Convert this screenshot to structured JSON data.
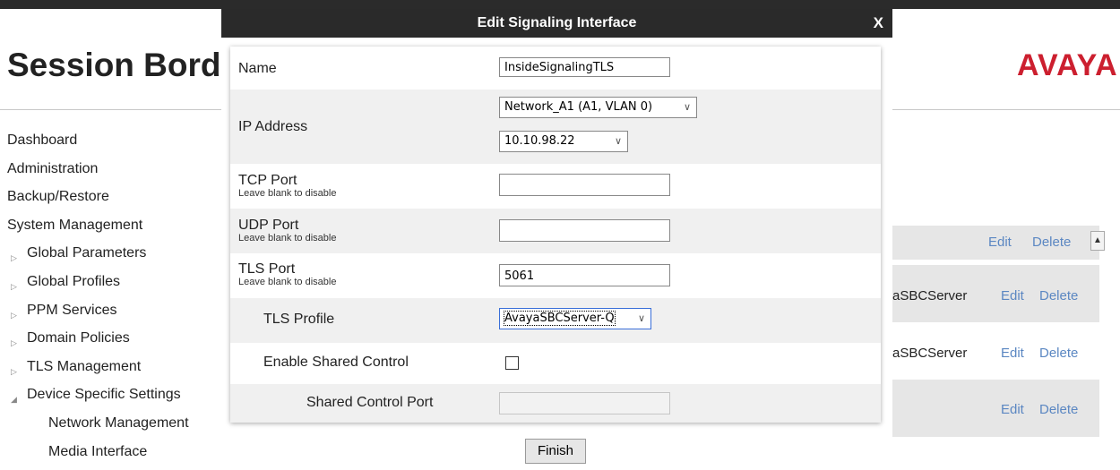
{
  "page": {
    "title": "Session Bord",
    "brand": "AVAYA"
  },
  "nav": {
    "items": [
      {
        "label": "Dashboard",
        "level": 1
      },
      {
        "label": "Administration",
        "level": 1
      },
      {
        "label": "Backup/Restore",
        "level": 1
      },
      {
        "label": "System Management",
        "level": 1
      },
      {
        "label": "Global Parameters",
        "level": 2,
        "expander": "▷"
      },
      {
        "label": "Global Profiles",
        "level": 2,
        "expander": "▷"
      },
      {
        "label": "PPM Services",
        "level": 2,
        "expander": "▷"
      },
      {
        "label": "Domain Policies",
        "level": 2,
        "expander": "▷"
      },
      {
        "label": "TLS Management",
        "level": 2,
        "expander": "▷"
      },
      {
        "label": "Device Specific Settings",
        "level": 2,
        "expander": "◢"
      },
      {
        "label": "Network Management",
        "level": 3
      },
      {
        "label": "Media Interface",
        "level": 3
      }
    ]
  },
  "background_grid": {
    "header_actions": {
      "edit": "Edit",
      "delete": "Delete"
    },
    "rows": [
      {
        "profile": "aSBCServer",
        "edit": "Edit",
        "delete": "Delete"
      },
      {
        "profile": "aSBCServer",
        "edit": "Edit",
        "delete": "Delete"
      },
      {
        "profile": "",
        "edit": "Edit",
        "delete": "Delete"
      }
    ]
  },
  "dialog": {
    "title": "Edit Signaling Interface",
    "close": "X",
    "fields": {
      "name": {
        "label": "Name",
        "value": "InsideSignalingTLS"
      },
      "ip_address": {
        "label": "IP Address",
        "network": "Network_A1 (A1, VLAN 0)",
        "address": "10.10.98.22"
      },
      "tcp_port": {
        "label": "TCP Port",
        "hint": "Leave blank to disable",
        "value": ""
      },
      "udp_port": {
        "label": "UDP Port",
        "hint": "Leave blank to disable",
        "value": ""
      },
      "tls_port": {
        "label": "TLS Port",
        "hint": "Leave blank to disable",
        "value": "5061"
      },
      "tls_profile": {
        "label": "TLS Profile",
        "value": "AvayaSBCServer-Q"
      },
      "enable_shared_control": {
        "label": "Enable Shared Control",
        "checked": false
      },
      "shared_control_port": {
        "label": "Shared Control Port",
        "value": ""
      }
    },
    "finish_label": "Finish"
  },
  "colors": {
    "titlebar": "#2a2a2a",
    "brand": "#cc1f2f",
    "link": "#5b87c2",
    "row_alt": "#f0f0f0"
  },
  "icons": {
    "dropdown": "chevron-down-icon",
    "close": "close-icon",
    "checkbox": "checkbox-unchecked",
    "scroll_up": "scroll-up-arrow-icon"
  }
}
